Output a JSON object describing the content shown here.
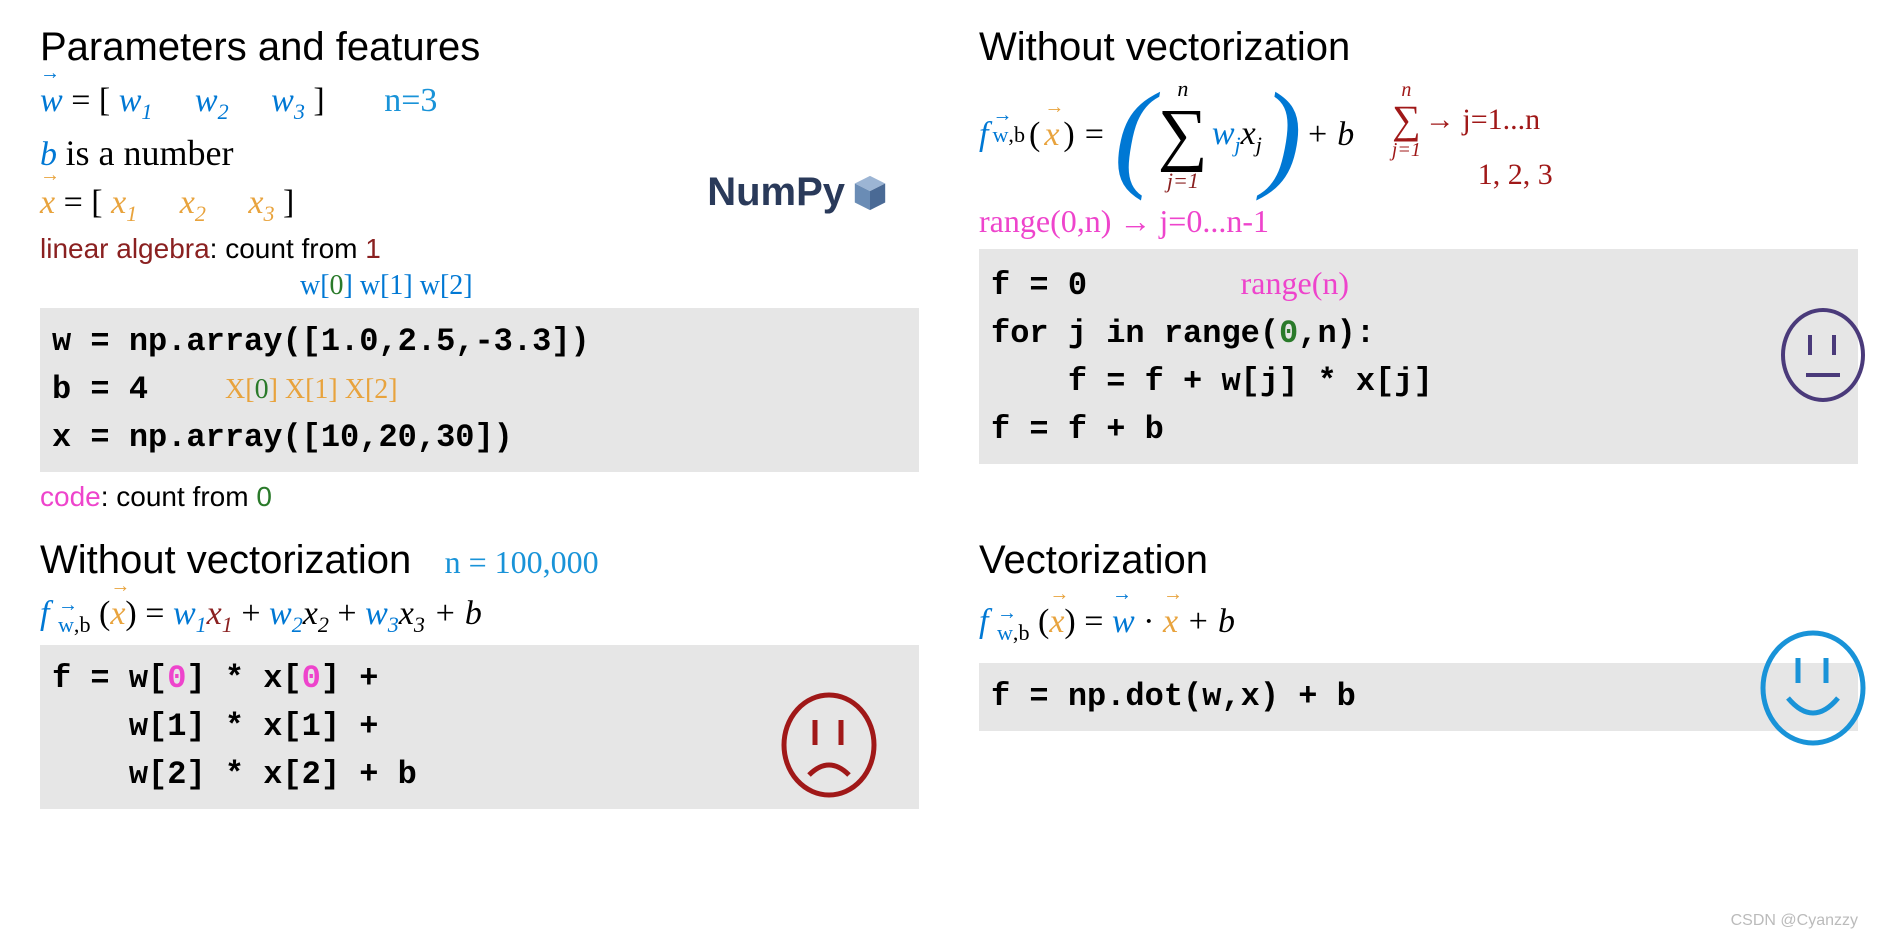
{
  "topLeft": {
    "heading": "Parameters and features",
    "wvec_label": "w",
    "wvec_eq": " = [",
    "w1": "w",
    "w1s": "1",
    "w2": "w",
    "w2s": "2",
    "w3": "w",
    "w3s": "3",
    "close": "]",
    "n_note": "n=3",
    "b_line_b": "b",
    "b_line_txt": " is a number",
    "xvec_label": "x",
    "x1": "x",
    "x1s": "1",
    "x2": "x",
    "x2s": "2",
    "x3": "x",
    "x3s": "3",
    "la_prefix": "linear algebra",
    "la_txt": ": count from ",
    "la_num": "1",
    "idx_w": "w[",
    "idx_w0": "0",
    "idx_w0c": "]   w[1]   w[2]",
    "code_w": "w = np.array([1.0,2.5,-3.3])",
    "code_b": "b = 4",
    "idx_x": "           X[",
    "idx_x0": "0",
    "idx_xc": "] X[1] X[2]",
    "code_x": "x = np.array([10,20,30])",
    "code_prefix": "code",
    "code_txt": ": count from ",
    "code_num": "0",
    "numpy": "NumPy"
  },
  "bottomLeft": {
    "heading": "Without vectorization",
    "n_note": "n = 100,000",
    "fn_f": "f",
    "fn_wb_w": "w",
    "fn_wb_b": ",b",
    "fn_x": "x",
    "eq": " = ",
    "t1w": "w",
    "t1ws": "1",
    "t1x": "x",
    "t1xs": "1",
    "plus": " + ",
    "t2w": "w",
    "t2ws": "2",
    "t2x": "x",
    "t2xs": "2",
    "t3w": "w",
    "t3ws": "3",
    "t3x": "x",
    "t3xs": "3",
    "plusb": " + b",
    "code1": "f = w[",
    "z0a": "0",
    "code1b": "] * x[",
    "z0b": "0",
    "code1c": "] +",
    "code2": "    w[1] * x[1] +",
    "code3": "    w[2] * x[2] + b"
  },
  "topRight": {
    "heading": "Without vectorization",
    "fn_f": "f",
    "fn_wb_w": "w",
    "fn_wb_b": ",b",
    "fn_x": "x",
    "eq": " = ",
    "sum_top": "n",
    "sum_bot": "j=1",
    "term_w": "w",
    "term_ws": "j",
    "term_x": "x",
    "term_xs": "j",
    "plusb": " + b",
    "red_sum_top": "n",
    "red_sum_bot": "j=1",
    "red_arrow": " → j=1...n",
    "red_123": "1, 2, 3",
    "range_note": "range(0,n) → j=0...n-1",
    "code_l1": "f = 0",
    "range_n": "range(n)",
    "code_l2a": "for j in range(",
    "code_l2_0": "0",
    "code_l2b": ",n):",
    "code_l3": "    f = f + w[j] * x[j]",
    "code_l4": "f = f + b"
  },
  "bottomRight": {
    "heading": "Vectorization",
    "fn_f": "f",
    "fn_wb_w": "w",
    "fn_wb_b": ",b",
    "fn_x": "x",
    "eq": " = ",
    "wvec": "w",
    "dot": " · ",
    "xvec": "x",
    "plusb": " + b",
    "code": "f = np.dot(w,x) + b"
  },
  "watermark": "CSDN @Cyanzzy"
}
